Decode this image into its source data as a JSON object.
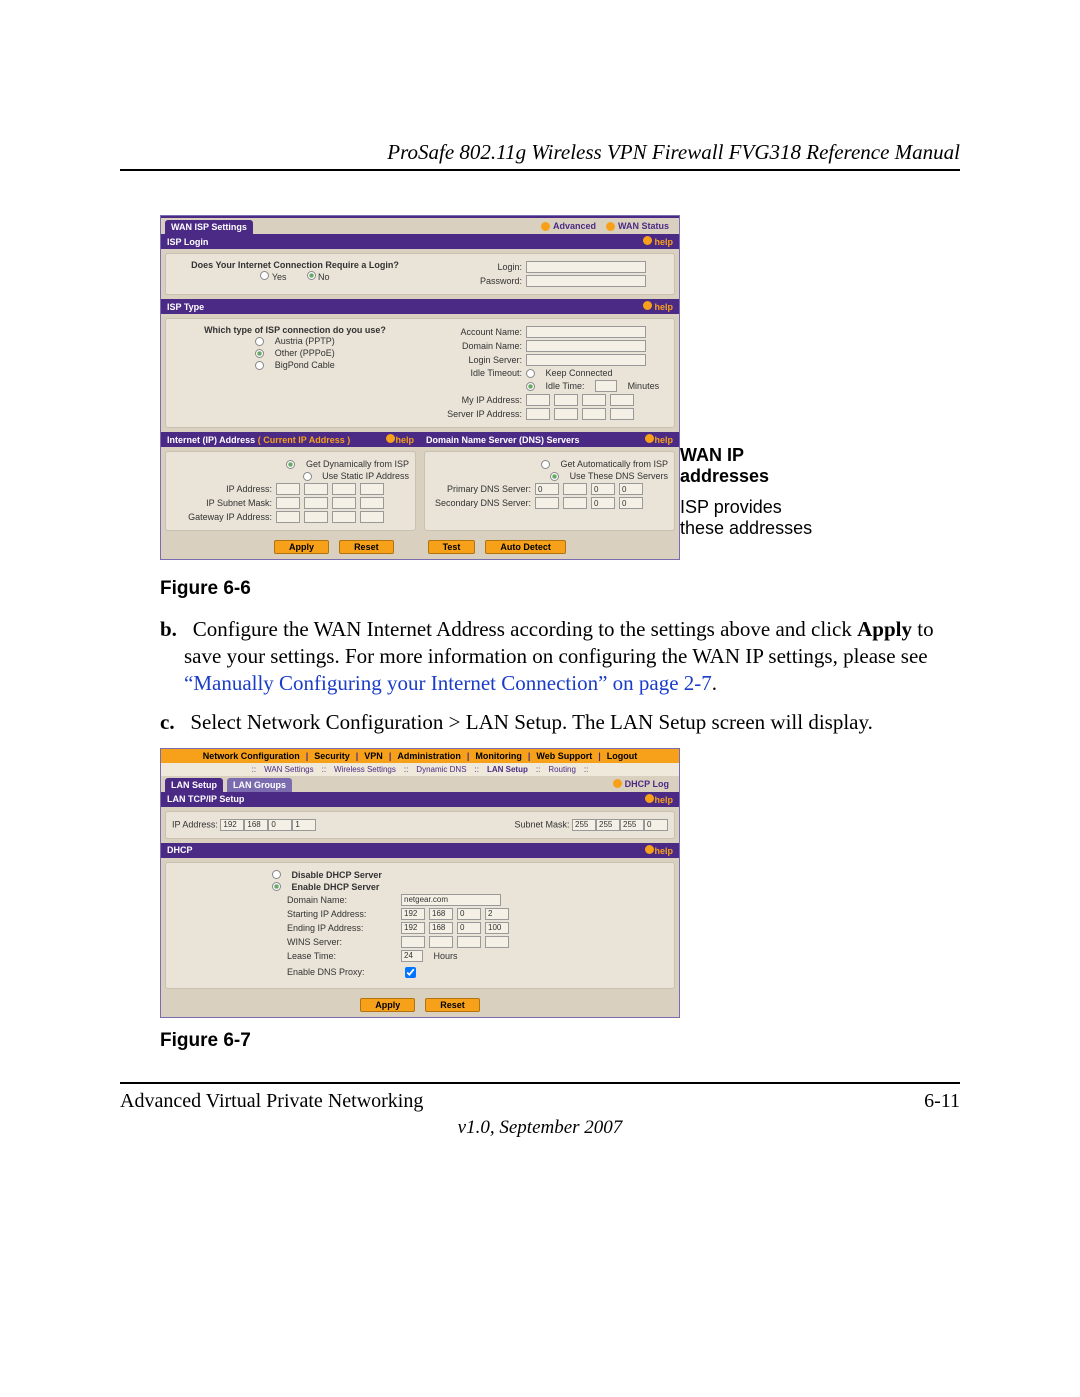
{
  "header_title": "ProSafe 802.11g Wireless VPN Firewall FVG318 Reference Manual",
  "fig66_caption": "Figure 6-6",
  "fig67_caption": "Figure 6-7",
  "wan": {
    "tab_title": "WAN ISP Settings",
    "advanced": "Advanced",
    "wan_status": "WAN Status",
    "help": "help",
    "isp_login_hdr": "ISP Login",
    "login_q": "Does Your Internet Connection Require a Login?",
    "yes": "Yes",
    "no": "No",
    "login_lbl": "Login:",
    "password_lbl": "Password:",
    "isp_type_hdr": "ISP Type",
    "isp_type_q": "Which type of ISP connection do you use?",
    "type1": "Austria (PPTP)",
    "type2": "Other (PPPoE)",
    "type3": "BigPond Cable",
    "acct_name": "Account Name:",
    "domain_name": "Domain Name:",
    "login_server": "Login Server:",
    "idle_timeout": "Idle Timeout:",
    "keep_connected": "Keep Connected",
    "idle_time": "Idle Time:",
    "minutes": "Minutes",
    "my_ip": "My IP Address:",
    "server_ip": "Server IP Address:",
    "ip_hdr": "Internet (IP) Address",
    "ip_current": "( Current IP Address )",
    "dns_hdr": "Domain Name Server (DNS) Servers",
    "get_dyn": "Get Dynamically from ISP",
    "use_static": "Use Static IP Address",
    "ip_address": "IP Address:",
    "ip_subnet": "IP Subnet Mask:",
    "gateway_ip": "Gateway IP Address:",
    "dns_auto": "Get Automatically from ISP",
    "dns_use": "Use These DNS Servers",
    "primary_dns": "Primary DNS Server:",
    "secondary_dns": "Secondary DNS Server:",
    "dns_a": [
      "0",
      "",
      "0",
      "0"
    ],
    "dns_b": [
      "",
      "",
      "0",
      "0"
    ],
    "btn_apply": "Apply",
    "btn_reset": "Reset",
    "btn_test": "Test",
    "btn_auto": "Auto Detect"
  },
  "annotation": {
    "title1": "WAN IP",
    "title2": "addresses",
    "sub1": "ISP provides",
    "sub2": "these addresses"
  },
  "step_b_letter": "b.",
  "step_b": "Configure the WAN Internet Address according to the settings above and click ",
  "step_b_bold": "Apply",
  "step_b_tail": " to save your settings. For more information on configuring the WAN IP settings, please see ",
  "step_b_link": "“Manually Configuring your Internet Connection” on page 2-7",
  "step_b_period": ".",
  "step_c_letter": "c.",
  "step_c": "Select Network Configuration > LAN Setup. The LAN Setup screen will display.",
  "lan": {
    "nav": [
      "Network Configuration",
      "Security",
      "VPN",
      "Administration",
      "Monitoring",
      "Web Support",
      "Logout"
    ],
    "subnav": [
      "WAN Settings",
      "Wireless Settings",
      "Dynamic DNS",
      "LAN Setup",
      "Routing"
    ],
    "tab1": "LAN Setup",
    "tab2": "LAN Groups",
    "dhcp_log": "DHCP Log",
    "s1_hdr": "LAN TCP/IP Setup",
    "ip_address_lbl": "IP Address:",
    "ip_address": [
      "192",
      "168",
      "0",
      "1"
    ],
    "subnet_lbl": "Subnet Mask:",
    "subnet": [
      "255",
      "255",
      "255",
      "0"
    ],
    "s2_hdr": "DHCP",
    "disable": "Disable DHCP Server",
    "enable": "Enable DHCP Server",
    "domain_lbl": "Domain Name:",
    "domain_val": "netgear.com",
    "start_lbl": "Starting IP Address:",
    "start_ip": [
      "192",
      "168",
      "0",
      "2"
    ],
    "end_lbl": "Ending IP Address:",
    "end_ip": [
      "192",
      "168",
      "0",
      "100"
    ],
    "wins_lbl": "WINS Server:",
    "wins_ip": [
      "",
      "",
      "",
      ""
    ],
    "lease_lbl": "Lease Time:",
    "lease_val": "24",
    "lease_unit": "Hours",
    "dnsproxy_lbl": "Enable DNS Proxy:",
    "btn_apply": "Apply",
    "btn_reset": "Reset",
    "help": "help"
  },
  "footer_left": "Advanced Virtual Private Networking",
  "footer_right": "6-11",
  "footer_ver": "v1.0, September 2007"
}
